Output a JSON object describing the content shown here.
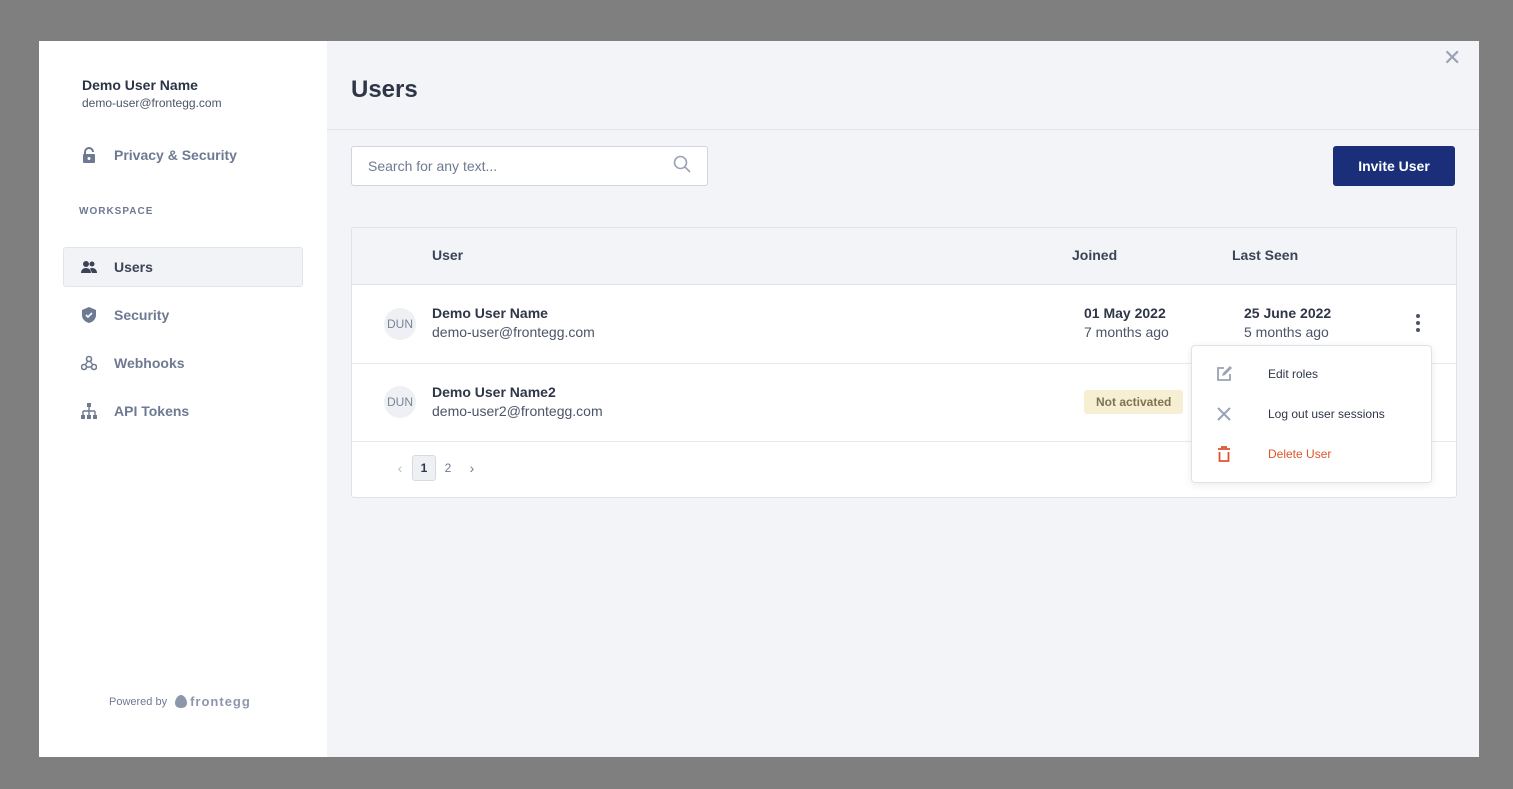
{
  "colors": {
    "accent": "#1a2e7a",
    "danger": "#e0542c",
    "badge_bg": "#f6efd4"
  },
  "sidebar": {
    "profile": {
      "name": "Demo User Name",
      "email": "demo-user@frontegg.com"
    },
    "privacy": {
      "label": "Privacy & Security",
      "icon": "lock-icon"
    },
    "section_label": "WORKSPACE",
    "items": [
      {
        "label": "Users",
        "icon": "users-icon",
        "active": true
      },
      {
        "label": "Security",
        "icon": "shield-icon",
        "active": false
      },
      {
        "label": "Webhooks",
        "icon": "webhooks-icon",
        "active": false
      },
      {
        "label": "API Tokens",
        "icon": "api-tokens-icon",
        "active": false
      }
    ],
    "powered_by": "Powered by",
    "brand": "frontegg"
  },
  "header": {
    "title": "Users"
  },
  "toolbar": {
    "search_placeholder": "Search for any text...",
    "invite_label": "Invite User"
  },
  "table": {
    "columns": [
      "User",
      "Joined",
      "Last Seen"
    ],
    "rows": [
      {
        "initials": "DUN",
        "name": "Demo User Name",
        "email": "demo-user@frontegg.com",
        "joined": "01 May 2022",
        "joined_ago": "7 months ago",
        "last_seen": "25 June 2022",
        "last_seen_ago": "5 months ago"
      },
      {
        "initials": "DUN",
        "name": "Demo User Name2",
        "email": "demo-user2@frontegg.com",
        "status": "Not activated"
      }
    ]
  },
  "pagination": {
    "pages": [
      "1",
      "2"
    ],
    "current": "1"
  },
  "row_menu": {
    "items": [
      {
        "label": "Edit roles",
        "icon": "edit-icon"
      },
      {
        "label": "Log out user sessions",
        "icon": "close-icon"
      },
      {
        "label": "Delete User",
        "icon": "trash-icon"
      }
    ]
  }
}
